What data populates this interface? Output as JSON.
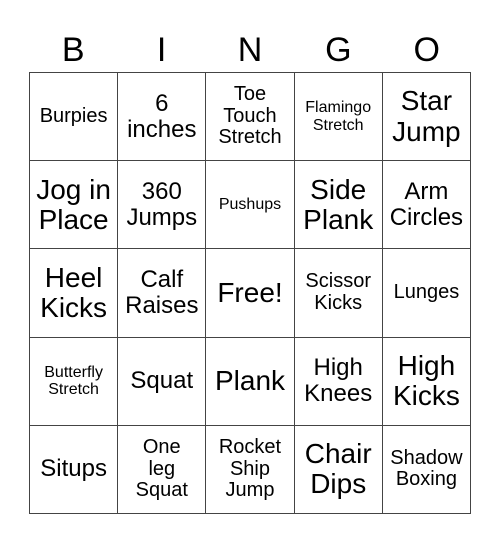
{
  "card": {
    "header": [
      "B",
      "I",
      "N",
      "G",
      "O"
    ],
    "rows": [
      [
        {
          "lines": [
            "Burpies"
          ],
          "size": "m"
        },
        {
          "lines": [
            "6",
            "inches"
          ],
          "size": "l"
        },
        {
          "lines": [
            "Toe",
            "Touch",
            "Stretch"
          ],
          "size": "m"
        },
        {
          "lines": [
            "Flamingo",
            "Stretch"
          ],
          "size": "s"
        },
        {
          "lines": [
            "Star",
            "Jump"
          ],
          "size": "xl"
        }
      ],
      [
        {
          "lines": [
            "Jog in",
            "Place"
          ],
          "size": "xl"
        },
        {
          "lines": [
            "360",
            "Jumps"
          ],
          "size": "l"
        },
        {
          "lines": [
            "Pushups"
          ],
          "size": "s"
        },
        {
          "lines": [
            "Side",
            "Plank"
          ],
          "size": "xl"
        },
        {
          "lines": [
            "Arm",
            "Circles"
          ],
          "size": "l"
        }
      ],
      [
        {
          "lines": [
            "Heel",
            "Kicks"
          ],
          "size": "xl"
        },
        {
          "lines": [
            "Calf",
            "Raises"
          ],
          "size": "l"
        },
        {
          "lines": [
            "Free!"
          ],
          "size": "xl"
        },
        {
          "lines": [
            "Scissor",
            "Kicks"
          ],
          "size": "m"
        },
        {
          "lines": [
            "Lunges"
          ],
          "size": "m"
        }
      ],
      [
        {
          "lines": [
            "Butterfly",
            "Stretch"
          ],
          "size": "s"
        },
        {
          "lines": [
            "Squat"
          ],
          "size": "l"
        },
        {
          "lines": [
            "Plank"
          ],
          "size": "xl"
        },
        {
          "lines": [
            "High",
            "Knees"
          ],
          "size": "l"
        },
        {
          "lines": [
            "High",
            "Kicks"
          ],
          "size": "xl"
        }
      ],
      [
        {
          "lines": [
            "Situps"
          ],
          "size": "l"
        },
        {
          "lines": [
            "One",
            "leg",
            "Squat"
          ],
          "size": "m"
        },
        {
          "lines": [
            "Rocket",
            "Ship",
            "Jump"
          ],
          "size": "m"
        },
        {
          "lines": [
            "Chair",
            "Dips"
          ],
          "size": "xl"
        },
        {
          "lines": [
            "Shadow",
            "Boxing"
          ],
          "size": "m"
        }
      ]
    ]
  }
}
